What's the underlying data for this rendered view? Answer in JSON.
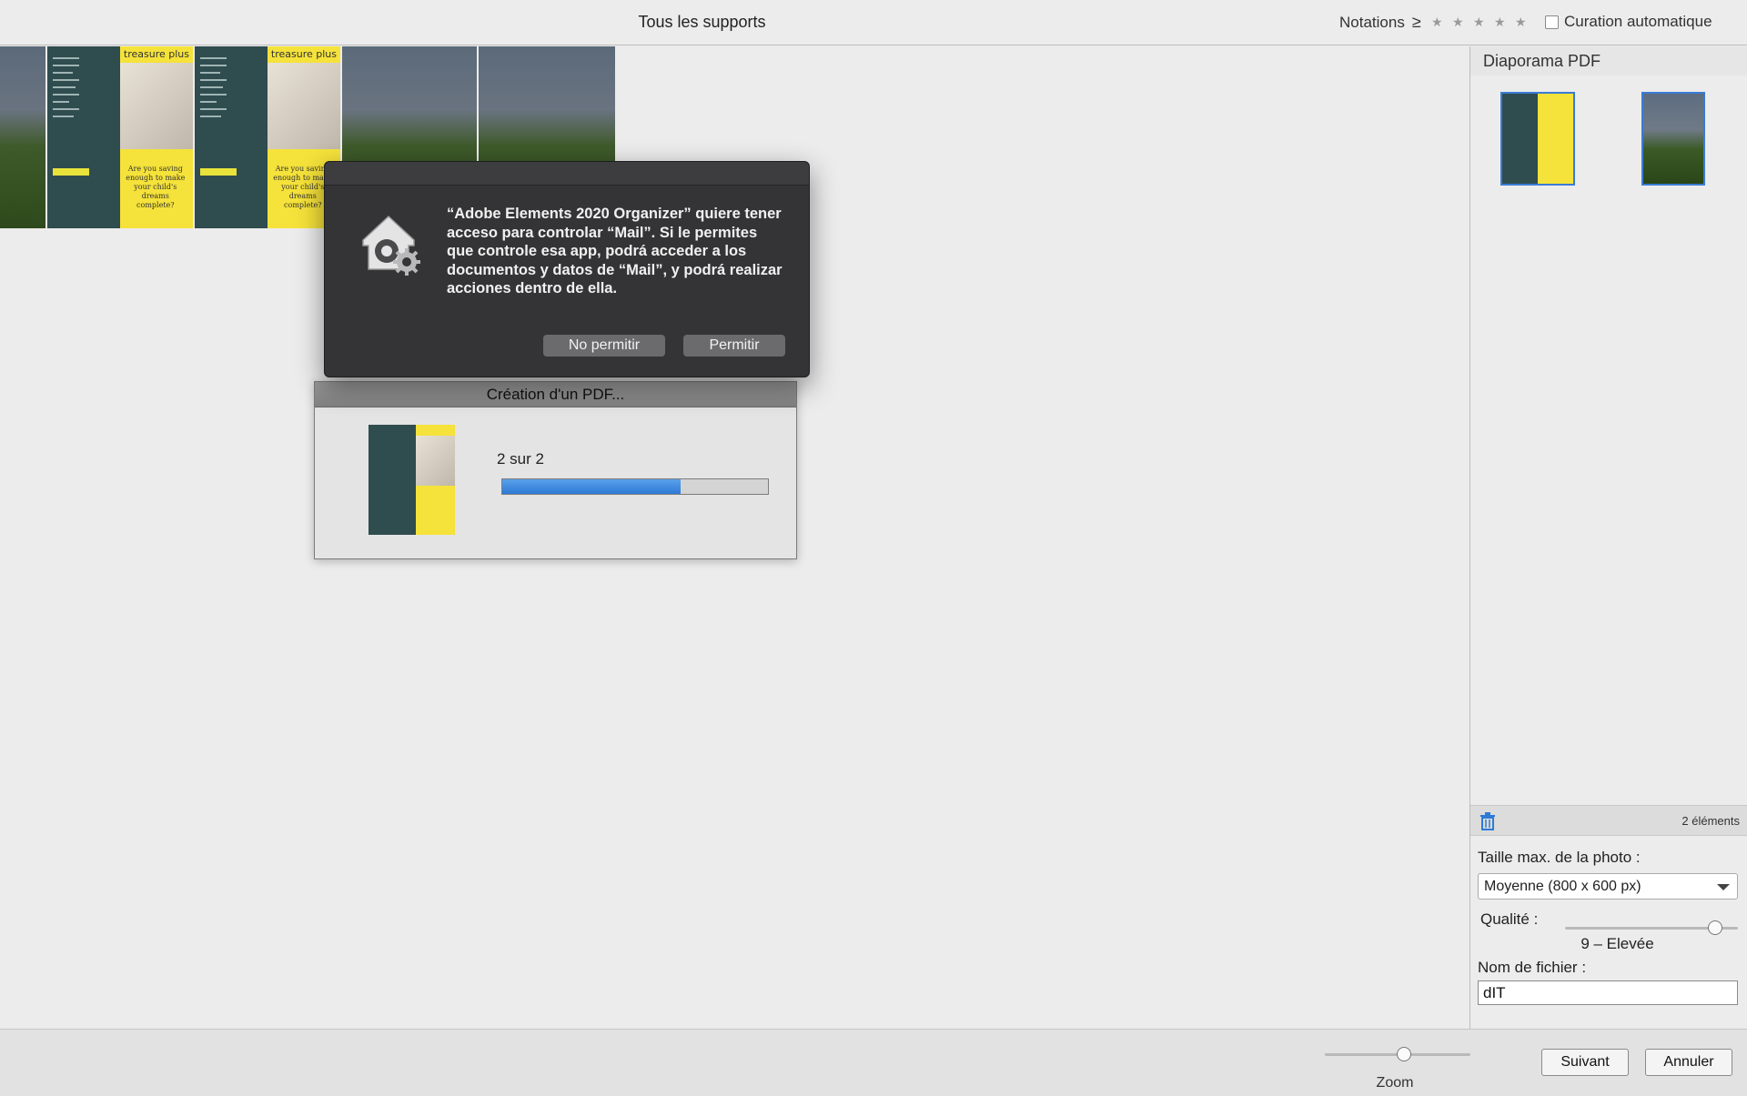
{
  "header": {
    "title": "Tous les supports",
    "ratings_label": "Notations",
    "ratings_operator": "≥",
    "stars_filled": 0,
    "stars_total": 5,
    "auto_curation_label": "Curation automatique"
  },
  "grid": {
    "doc_logo": "treasure plus",
    "doc_tagline": "Are you saving enough to make your child's dreams complete?"
  },
  "right_panel": {
    "title": "Diaporama PDF",
    "items_count": "2 éléments",
    "photo_size_label": "Taille max. de la photo :",
    "photo_size_value": "Moyenne (800 x 600 px)",
    "quality_label": "Qualité :",
    "quality_fraction": 0.9,
    "quality_value": "9 – Elevée",
    "filename_label": "Nom de fichier :",
    "filename_value": "dIT"
  },
  "bottom": {
    "zoom_label": "Zoom",
    "zoom_fraction": 0.55,
    "next_button": "Suivant",
    "cancel_button": "Annuler"
  },
  "progress_dialog": {
    "title": "Création d'un PDF...",
    "count": "2 sur 2",
    "progress_fraction": 0.67
  },
  "alert": {
    "message": "“Adobe Elements 2020 Organizer” quiere tener acceso para controlar “Mail”. Si le permites que controle esa app, podrá acceder a los documentos y datos de “Mail”, y podrá realizar acciones dentro de ella.",
    "deny_button": "No permitir",
    "allow_button": "Permitir"
  },
  "colors": {
    "accent_blue": "#3a7bd5",
    "progress_blue": "#2e7ad6",
    "alert_bg": "#343436",
    "doc_teal": "#2f4c4f",
    "doc_yellow": "#f5e23a"
  }
}
